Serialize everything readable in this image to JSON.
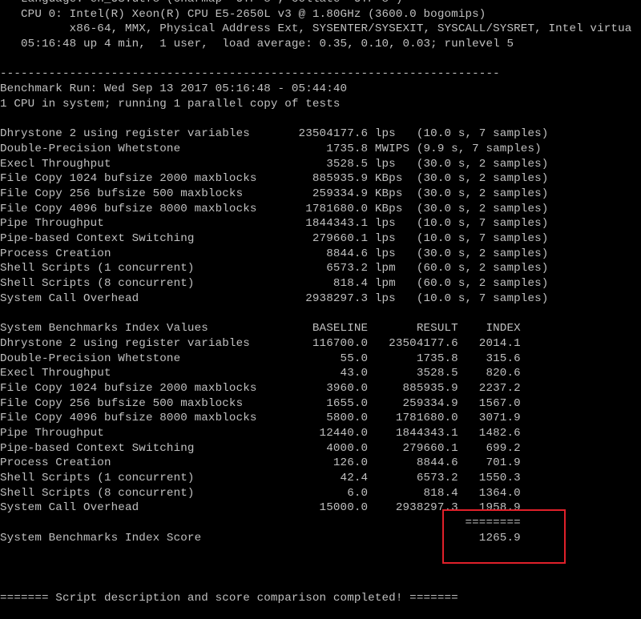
{
  "terminal": {
    "lines": [
      "   Language: en_US.utf8 (charmap=\"UTF-8\", collate=\"UTF-8\")",
      "   CPU 0: Intel(R) Xeon(R) CPU E5-2650L v3 @ 1.80GHz (3600.0 bogomips)",
      "          x86-64, MMX, Physical Address Ext, SYSENTER/SYSEXIT, SYSCALL/SYSRET, Intel virtua",
      "   05:16:48 up 4 min,  1 user,  load average: 0.35, 0.10, 0.03; runlevel 5",
      "",
      "------------------------------------------------------------------------",
      "Benchmark Run: Wed Sep 13 2017 05:16:48 - 05:44:40",
      "1 CPU in system; running 1 parallel copy of tests",
      "",
      "Dhrystone 2 using register variables       23504177.6 lps   (10.0 s, 7 samples)",
      "Double-Precision Whetstone                     1735.8 MWIPS (9.9 s, 7 samples)",
      "Execl Throughput                               3528.5 lps   (30.0 s, 2 samples)",
      "File Copy 1024 bufsize 2000 maxblocks        885935.9 KBps  (30.0 s, 2 samples)",
      "File Copy 256 bufsize 500 maxblocks          259334.9 KBps  (30.0 s, 2 samples)",
      "File Copy 4096 bufsize 8000 maxblocks       1781680.0 KBps  (30.0 s, 2 samples)",
      "Pipe Throughput                             1844343.1 lps   (10.0 s, 7 samples)",
      "Pipe-based Context Switching                 279660.1 lps   (10.0 s, 7 samples)",
      "Process Creation                               8844.6 lps   (30.0 s, 2 samples)",
      "Shell Scripts (1 concurrent)                   6573.2 lpm   (60.0 s, 2 samples)",
      "Shell Scripts (8 concurrent)                    818.4 lpm   (60.0 s, 2 samples)",
      "System Call Overhead                        2938297.3 lps   (10.0 s, 7 samples)",
      "",
      "System Benchmarks Index Values               BASELINE       RESULT    INDEX",
      "Dhrystone 2 using register variables         116700.0   23504177.6   2014.1",
      "Double-Precision Whetstone                       55.0       1735.8    315.6",
      "Execl Throughput                                 43.0       3528.5    820.6",
      "File Copy 1024 bufsize 2000 maxblocks          3960.0     885935.9   2237.2",
      "File Copy 256 bufsize 500 maxblocks            1655.0     259334.9   1567.0",
      "File Copy 4096 bufsize 8000 maxblocks          5800.0    1781680.0   3071.9",
      "Pipe Throughput                               12440.0    1844343.1   1482.6",
      "Pipe-based Context Switching                   4000.0     279660.1    699.2",
      "Process Creation                                126.0       8844.6    701.9",
      "Shell Scripts (1 concurrent)                     42.4       6573.2   1550.3",
      "Shell Scripts (8 concurrent)                      6.0        818.4   1364.0",
      "System Call Overhead                          15000.0    2938297.3   1958.9",
      "                                                                   ========",
      "System Benchmarks Index Score                                        1265.9",
      "",
      "",
      "",
      "======= Script description and score comparison completed! ======="
    ],
    "highlight_color": "#e0202a",
    "text_color": "#c0c0c0",
    "background_color": "#000000"
  }
}
